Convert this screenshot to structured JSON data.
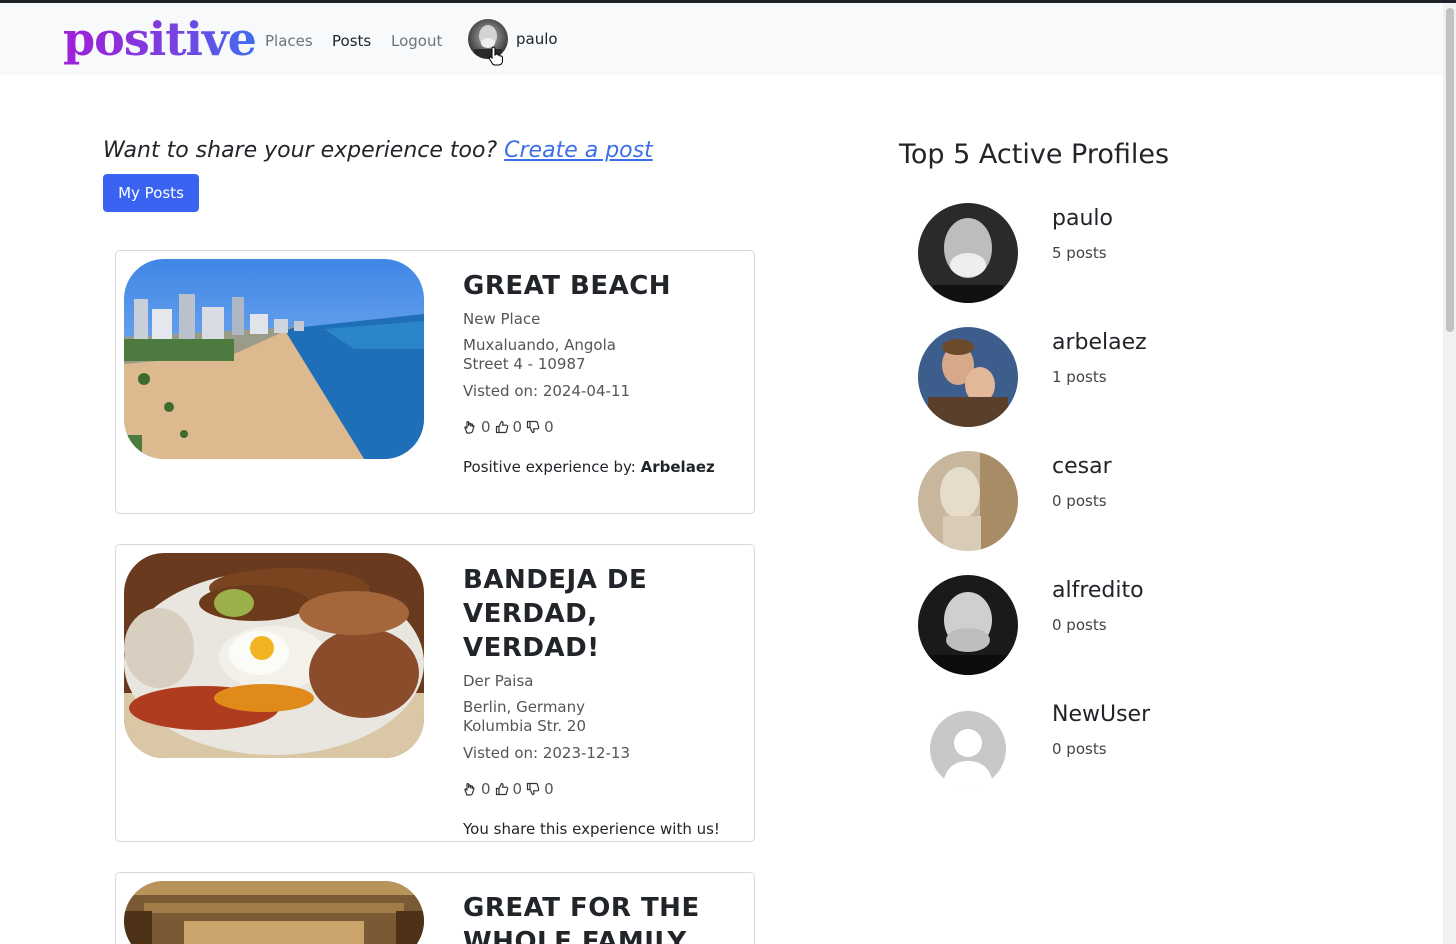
{
  "nav": {
    "brand": "positive",
    "links": [
      "Places",
      "Posts",
      "Logout"
    ],
    "active_link": "Posts",
    "username": "paulo"
  },
  "share": {
    "prompt": "Want to share your experience too?",
    "link_label": "Create a post",
    "my_posts_label": "My Posts"
  },
  "posts": [
    {
      "title": "GREAT BEACH",
      "place": "New Place",
      "address_line1": "Muxaluando, Angola",
      "address_line2": "Street 4 - 10987",
      "visited": "Visted on: 2024-04-11",
      "reactions": {
        "clap": "0",
        "up": "0",
        "down": "0"
      },
      "footer_prefix": "Positive experience by:",
      "footer_author": "Arbelaez"
    },
    {
      "title": "BANDEJA DE VERDAD, VERDAD!",
      "place": "Der Paisa",
      "address_line1": "Berlin, Germany",
      "address_line2": "Kolumbia Str. 20",
      "visited": "Visted on: 2023-12-13",
      "reactions": {
        "clap": "0",
        "up": "0",
        "down": "0"
      },
      "footer_prefix": "You share this experience with us!",
      "footer_author": ""
    },
    {
      "title": "GREAT FOR THE WHOLE FAMILY"
    }
  ],
  "profiles": {
    "title": "Top 5 Active Profiles",
    "items": [
      {
        "name": "paulo",
        "count": "5 posts"
      },
      {
        "name": "arbelaez",
        "count": "1 posts"
      },
      {
        "name": "cesar",
        "count": "0 posts"
      },
      {
        "name": "alfredito",
        "count": "0 posts"
      },
      {
        "name": "NewUser",
        "count": "0 posts"
      }
    ]
  },
  "colors": {
    "accent": "#3a63f2",
    "link": "#3d6fe8",
    "brand_gradient_start": "#a020d8",
    "brand_gradient_end": "#3f6ef0"
  },
  "icons": [
    "clap-icon",
    "thumbs-up-icon",
    "thumbs-down-icon",
    "avatar-placeholder-icon"
  ]
}
